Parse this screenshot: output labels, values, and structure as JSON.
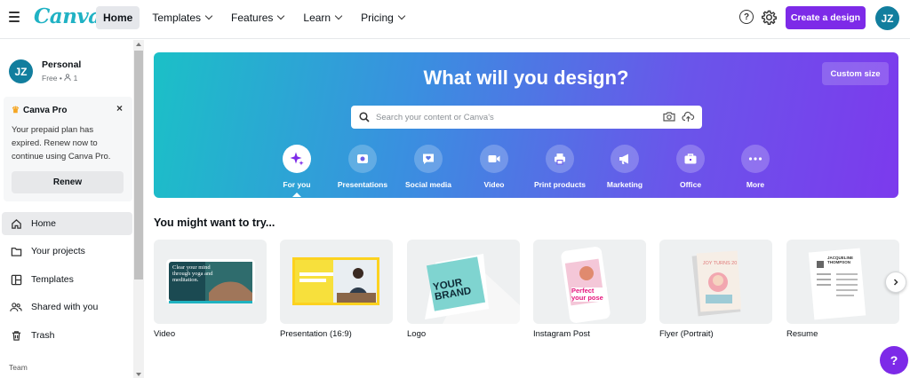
{
  "app": {
    "logo": "Canva"
  },
  "nav": {
    "home": "Home",
    "templates": "Templates",
    "features": "Features",
    "learn": "Learn",
    "pricing": "Pricing"
  },
  "header": {
    "help_glyph": "?",
    "create_label": "Create a design",
    "avatar_initials": "JZ"
  },
  "account": {
    "initials": "JZ",
    "name": "Personal",
    "plan": "Free •",
    "members": "1"
  },
  "pro_panel": {
    "title": "Canva Pro",
    "close": "×",
    "message": "Your prepaid plan has expired. Renew now to continue using Canva Pro.",
    "renew": "Renew"
  },
  "sidebar": {
    "items": [
      {
        "label": "Home",
        "icon": "home-icon"
      },
      {
        "label": "Your projects",
        "icon": "folder-icon"
      },
      {
        "label": "Templates",
        "icon": "templates-icon"
      },
      {
        "label": "Shared with you",
        "icon": "people-icon"
      },
      {
        "label": "Trash",
        "icon": "trash-icon"
      }
    ],
    "team_label": "Team"
  },
  "hero": {
    "title": "What will you design?",
    "custom_size": "Custom size",
    "search_placeholder": "Search your content or Canva's",
    "categories": [
      {
        "label": "For you",
        "icon": "sparkle-icon"
      },
      {
        "label": "Presentations",
        "icon": "presentation-icon"
      },
      {
        "label": "Social media",
        "icon": "heart-chat-icon"
      },
      {
        "label": "Video",
        "icon": "video-icon"
      },
      {
        "label": "Print products",
        "icon": "printer-icon"
      },
      {
        "label": "Marketing",
        "icon": "megaphone-icon"
      },
      {
        "label": "Office",
        "icon": "briefcase-icon"
      },
      {
        "label": "More",
        "icon": "more-icon"
      }
    ]
  },
  "suggestions": {
    "title": "You might want to try...",
    "cards": [
      {
        "label": "Video",
        "thumb_text": "Clear your mind through yoga and meditation."
      },
      {
        "label": "Presentation (16:9)"
      },
      {
        "label": "Logo",
        "thumb_text": "YOUR BRAND"
      },
      {
        "label": "Instagram Post",
        "thumb_text": "Perfect your pose"
      },
      {
        "label": "Flyer (Portrait)",
        "thumb_text": "JOY TURNS 20"
      },
      {
        "label": "Resume",
        "thumb_text": "JACQUELINE THOMPSON"
      }
    ]
  },
  "colors": {
    "brand_purple": "#7d2ae8",
    "avatar_teal": "#127e9e",
    "logo_teal": "#20b2c4"
  }
}
